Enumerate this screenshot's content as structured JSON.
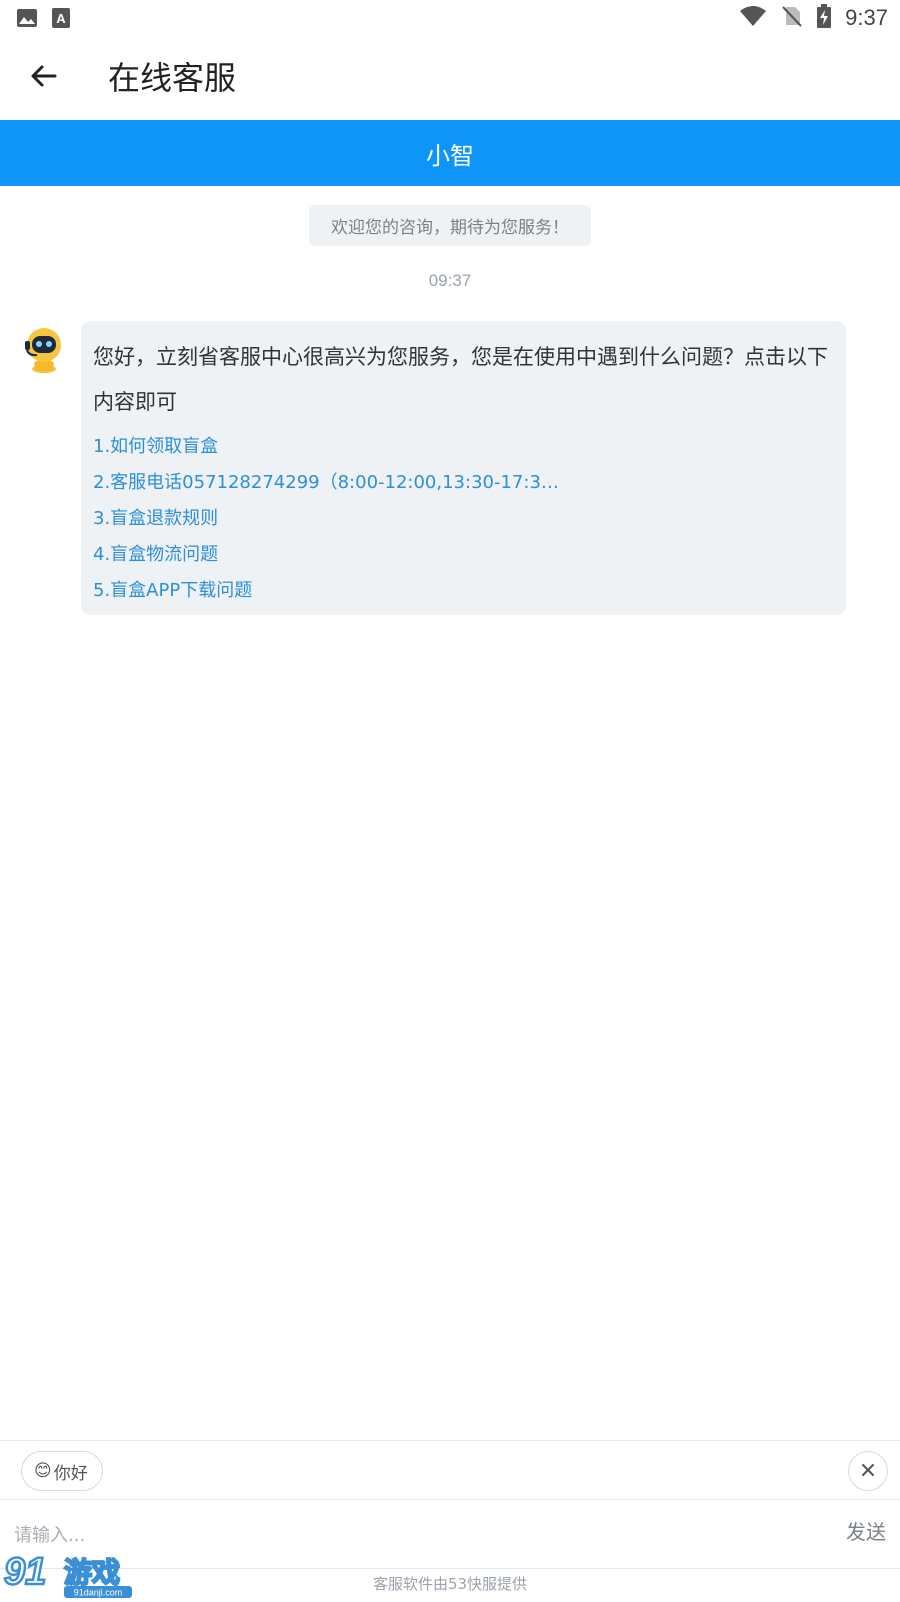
{
  "status_bar": {
    "time": "9:37",
    "left_icons": [
      "image-icon",
      "a-text-icon"
    ],
    "right_icons": [
      "wifi-icon",
      "no-sim-icon",
      "battery-charging-icon"
    ]
  },
  "app_bar": {
    "back_icon": "arrow-left-icon",
    "title": "在线客服"
  },
  "agent_header": {
    "name": "小智",
    "color": "#0f95f7"
  },
  "chat": {
    "welcome": "欢迎您的咨询，期待为您服务！",
    "timestamp": "09:37",
    "messages": [
      {
        "sender": "bot",
        "avatar_icon": "robot-avatar-icon",
        "text": "您好，立刻省客服中心很高兴为您服务，您是在使用中遇到什么问题？点击以下内容即可",
        "links": [
          "1.如何领取盲盒",
          "2.客服电话057128274299（8:00-12:00,13:30-17:3…",
          "3.盲盒退款规则",
          "4.盲盒物流问题",
          "5.盲盒APP下载问题"
        ]
      }
    ]
  },
  "quick_replies": {
    "chip": {
      "emoji": "😊",
      "label": "你好"
    },
    "close_icon": "close-icon"
  },
  "composer": {
    "placeholder": "请输入...",
    "value": "",
    "send_label": "发送"
  },
  "footer": {
    "note": "客服软件由53快服提供"
  },
  "watermark": {
    "text": "91游戏",
    "subtext": "91danji.com"
  },
  "colors": {
    "accent": "#0f95f7",
    "link": "#2d8fd8",
    "bubble_bg": "#eff2f5"
  }
}
